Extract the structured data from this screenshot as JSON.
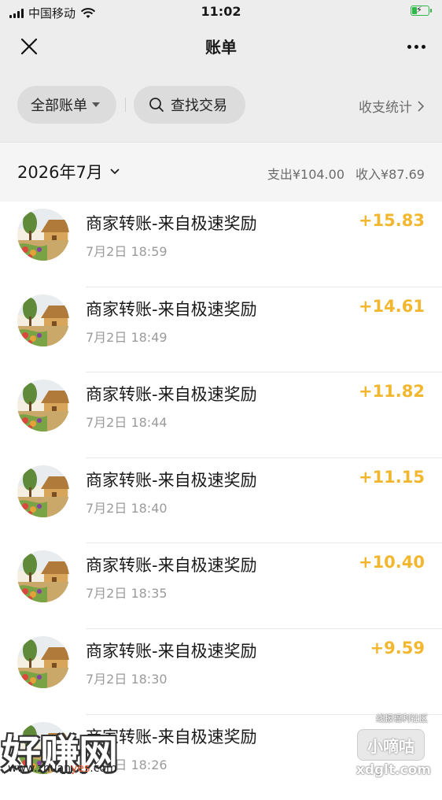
{
  "status_bar": {
    "carrier": "中国移动",
    "time": "11:02"
  },
  "nav": {
    "title": "账单",
    "close_icon": "close-icon",
    "more_icon": "more-icon"
  },
  "filters": {
    "all_bills": "全部账单",
    "search": "查找交易",
    "stats": "收支统计"
  },
  "month": {
    "label": "2026年7月",
    "expense": "支出¥104.00",
    "income": "收入¥87.69"
  },
  "transactions": [
    {
      "title": "商家转账-来自极速奖励",
      "time": "7月2日 18:59",
      "amount": "+15.83"
    },
    {
      "title": "商家转账-来自极速奖励",
      "time": "7月2日 18:49",
      "amount": "+14.61"
    },
    {
      "title": "商家转账-来自极速奖励",
      "time": "7月2日 18:44",
      "amount": "+11.82"
    },
    {
      "title": "商家转账-来自极速奖励",
      "time": "7月2日 18:40",
      "amount": "+11.15"
    },
    {
      "title": "商家转账-来自极速奖励",
      "time": "7月2日 18:35",
      "amount": "+10.40"
    },
    {
      "title": "商家转账-来自极速奖励",
      "time": "7月2日 18:30",
      "amount": "+9.59"
    },
    {
      "title": "商家转账-来自极速奖励",
      "time": "7月2日 18:26",
      "amount": ""
    }
  ],
  "watermarks": {
    "left_big": "好赚网",
    "left_url_a": "www.zhuan",
    "left_url_b": "yes",
    "left_url_c": ".com",
    "right_top": "线报福利社区",
    "right_box": "小嘀咕",
    "right_domain": "xdglt.com"
  },
  "colors": {
    "income_amount": "#f2b72f",
    "header_bg": "#ededed"
  }
}
